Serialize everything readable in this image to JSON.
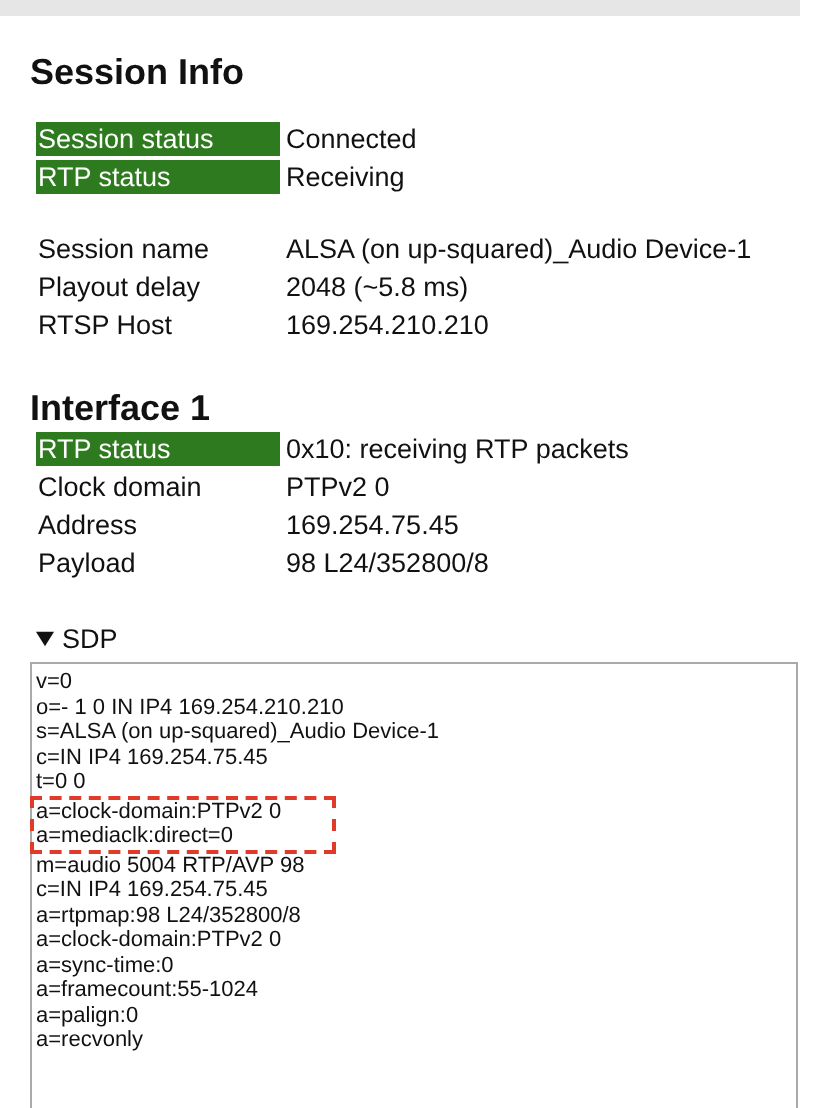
{
  "session_info": {
    "title": "Session Info",
    "status_rows": [
      {
        "label": "Session status",
        "value": "Connected",
        "highlighted": true
      },
      {
        "label": "RTP status",
        "value": "Receiving",
        "highlighted": true
      }
    ],
    "rows": [
      {
        "label": "Session name",
        "value": "ALSA (on up-squared)_Audio Device-1",
        "highlighted": false
      },
      {
        "label": "Playout delay",
        "value": "2048 (~5.8 ms)",
        "highlighted": false
      },
      {
        "label": "RTSP Host",
        "value": "169.254.210.210",
        "highlighted": false
      }
    ]
  },
  "interface": {
    "title": "Interface 1",
    "rows": [
      {
        "label": "RTP status",
        "value": "0x10: receiving RTP packets",
        "highlighted": true
      },
      {
        "label": "Clock domain",
        "value": "PTPv2 0",
        "highlighted": false
      },
      {
        "label": "Address",
        "value": "169.254.75.45",
        "highlighted": false
      },
      {
        "label": "Payload",
        "value": "98 L24/352800/8",
        "highlighted": false
      }
    ]
  },
  "sdp": {
    "summary": "SDP",
    "expanded": true,
    "lines": [
      {
        "text": "v=0",
        "marked": false
      },
      {
        "text": "o=- 1 0 IN IP4 169.254.210.210",
        "marked": false
      },
      {
        "text": "s=ALSA (on up-squared)_Audio Device-1",
        "marked": false
      },
      {
        "text": "c=IN IP4 169.254.75.45",
        "marked": false
      },
      {
        "text": "t=0 0",
        "marked": false
      },
      {
        "text": "a=clock-domain:PTPv2 0",
        "marked": true
      },
      {
        "text": "a=mediaclk:direct=0",
        "marked": true
      },
      {
        "text": "m=audio 5004 RTP/AVP 98",
        "marked": false
      },
      {
        "text": "c=IN IP4 169.254.75.45",
        "marked": false
      },
      {
        "text": "a=rtpmap:98 L24/352800/8",
        "marked": false
      },
      {
        "text": "a=clock-domain:PTPv2 0",
        "marked": false
      },
      {
        "text": "a=sync-time:0",
        "marked": false
      },
      {
        "text": "a=framecount:55-1024",
        "marked": false
      },
      {
        "text": "a=palign:0",
        "marked": false
      },
      {
        "text": "a=recvonly",
        "marked": false
      }
    ]
  }
}
